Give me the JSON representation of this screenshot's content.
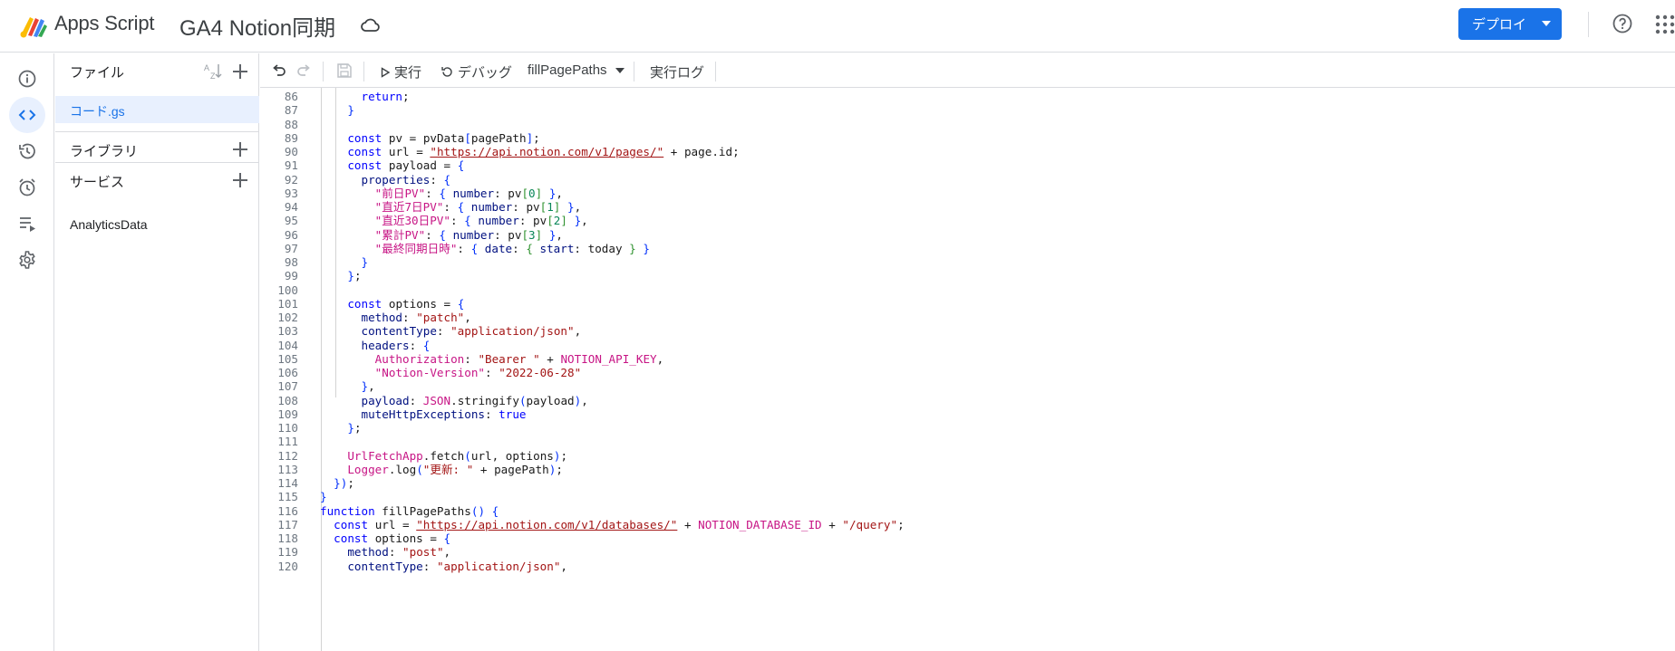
{
  "header": {
    "app_name": "Apps Script",
    "project_title": "GA4 Notion同期",
    "deploy_label": "デプロイ"
  },
  "rail": {
    "items": [
      "overview",
      "editor",
      "history",
      "triggers",
      "executions",
      "settings"
    ],
    "active": "editor"
  },
  "files": {
    "title": "ファイル",
    "items": [
      "コード.gs"
    ],
    "libraries_label": "ライブラリ",
    "services_label": "サービス",
    "services": [
      "AnalyticsData"
    ]
  },
  "toolbar": {
    "run_label": "実行",
    "debug_label": "デバッグ",
    "function_name": "fillPagePaths",
    "log_label": "実行ログ"
  },
  "code_lines": [
    {
      "n": "86",
      "t": "      return;"
    },
    {
      "n": "87",
      "t": "    }"
    },
    {
      "n": "88",
      "t": ""
    },
    {
      "n": "89",
      "t": "    const pv = pvData[pagePath];"
    },
    {
      "n": "90",
      "t": "    const url = \"https://api.notion.com/v1/pages/\" + page.id;"
    },
    {
      "n": "91",
      "t": "    const payload = {"
    },
    {
      "n": "92",
      "t": "      properties: {"
    },
    {
      "n": "93",
      "t": "        \"前日PV\": { number: pv[0] },"
    },
    {
      "n": "94",
      "t": "        \"直近7日PV\": { number: pv[1] },"
    },
    {
      "n": "95",
      "t": "        \"直近30日PV\": { number: pv[2] },"
    },
    {
      "n": "96",
      "t": "        \"累計PV\": { number: pv[3] },"
    },
    {
      "n": "97",
      "t": "        \"最終同期日時\": { date: { start: today } }"
    },
    {
      "n": "98",
      "t": "      }"
    },
    {
      "n": "99",
      "t": "    };"
    },
    {
      "n": "100",
      "t": ""
    },
    {
      "n": "101",
      "t": "    const options = {"
    },
    {
      "n": "102",
      "t": "      method: \"patch\","
    },
    {
      "n": "103",
      "t": "      contentType: \"application/json\","
    },
    {
      "n": "104",
      "t": "      headers: {"
    },
    {
      "n": "105",
      "t": "        Authorization: \"Bearer \" + NOTION_API_KEY,"
    },
    {
      "n": "106",
      "t": "        \"Notion-Version\": \"2022-06-28\""
    },
    {
      "n": "107",
      "t": "      },"
    },
    {
      "n": "108",
      "t": "      payload: JSON.stringify(payload),"
    },
    {
      "n": "109",
      "t": "      muteHttpExceptions: true"
    },
    {
      "n": "110",
      "t": "    };"
    },
    {
      "n": "111",
      "t": ""
    },
    {
      "n": "112",
      "t": "    UrlFetchApp.fetch(url, options);"
    },
    {
      "n": "113",
      "t": "    Logger.log(\"更新: \" + pagePath);"
    },
    {
      "n": "114",
      "t": "  });"
    },
    {
      "n": "115",
      "t": "}"
    },
    {
      "n": "116",
      "t": "function fillPagePaths() {"
    },
    {
      "n": "117",
      "t": "  const url = \"https://api.notion.com/v1/databases/\" + NOTION_DATABASE_ID + \"/query\";"
    },
    {
      "n": "118",
      "t": "  const options = {"
    },
    {
      "n": "119",
      "t": "    method: \"post\","
    },
    {
      "n": "120",
      "t": "    contentType: \"application/json\","
    }
  ]
}
